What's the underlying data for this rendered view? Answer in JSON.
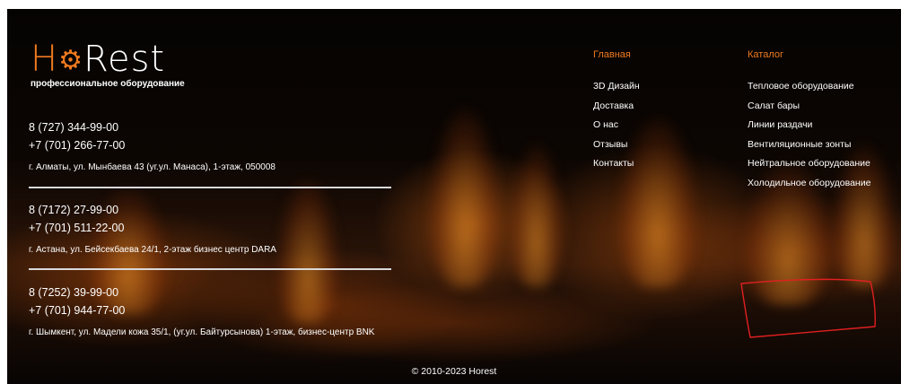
{
  "logo": {
    "part1": "H",
    "part2": "Rest",
    "tagline": "профессиональное оборудование",
    "accent_color": "#f07a1e",
    "gear_icon": "gear-icon"
  },
  "offices": [
    {
      "phone1": "8 (727) 344-99-00",
      "phone2": "+7 (701) 266-77-00",
      "address": "г. Алматы, ул. Мынбаева 43 (уг.ул. Манаса), 1-этаж, 050008"
    },
    {
      "phone1": "8 (7172) 27-99-00",
      "phone2": "+7 (701) 511-22-00",
      "address": "г. Астана, ул. Бейсекбаева 24/1, 2-этаж бизнес центр DARA"
    },
    {
      "phone1": "8 (7252) 39-99-00",
      "phone2": "+7 (701) 944-77-00",
      "address": "г. Шымкент, ул. Мадели кожа 35/1, (уг.ул. Байтурсынова) 1-этаж, бизнес-центр BNK"
    }
  ],
  "nav_main": {
    "title": "Главная",
    "items": [
      "3D Дизайн",
      "Доставка",
      "О нас",
      "Отзывы",
      "Контакты"
    ]
  },
  "nav_catalog": {
    "title": "Каталог",
    "items": [
      "Тепловое оборудование",
      "Салат бары",
      "Линии раздачи",
      "Вентиляционные зонты",
      "Нейтральное оборудование",
      "Холодильное оборудование"
    ]
  },
  "copyright": "© 2010-2023 Horest",
  "annotation_color": "#e02020"
}
